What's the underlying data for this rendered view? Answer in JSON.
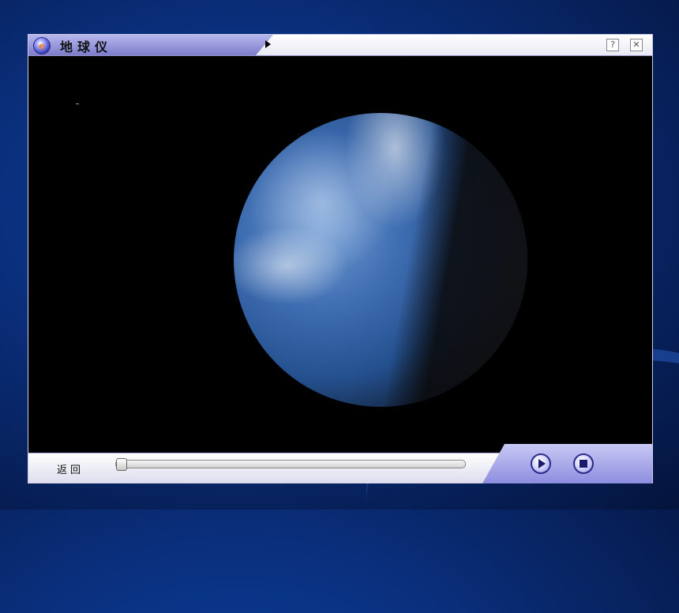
{
  "window": {
    "title": "地球仪",
    "logo_letter": "e",
    "help_label": "?",
    "close_label": "✕"
  },
  "controls": {
    "back_label": "返回",
    "progress_fraction": 0.0
  },
  "icons": {
    "logo": "app-logo-icon",
    "expand": "expand-arrow-icon",
    "help": "help-icon",
    "close": "close-icon",
    "play": "play-icon",
    "stop": "stop-icon"
  },
  "colors": {
    "background": "#0a2f7c",
    "tab_purple": "#8d8de0",
    "video_bg": "#000000"
  }
}
